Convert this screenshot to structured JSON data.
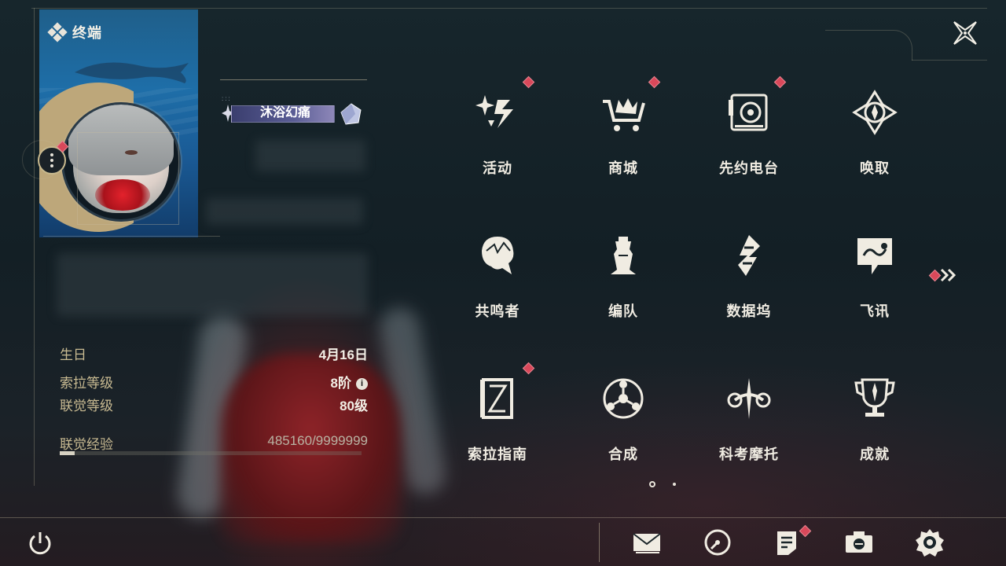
{
  "window": {
    "title": "终端"
  },
  "profile": {
    "title_badge": "沐浴幻痛",
    "stats": [
      {
        "label": "生日",
        "value": "4月16日"
      },
      {
        "label": "索拉等级",
        "value": "8阶"
      },
      {
        "label": "联觉等级",
        "value": "80级"
      }
    ],
    "exp": {
      "label": "联觉经验",
      "value": "485160/9999999",
      "fraction": 0.0485
    }
  },
  "menu": {
    "items": [
      {
        "label": "活动",
        "icon": "sparkle-icon",
        "badge": true
      },
      {
        "label": "商城",
        "icon": "cart-icon",
        "badge": true
      },
      {
        "label": "先约电台",
        "icon": "radio-icon",
        "badge": true
      },
      {
        "label": "唤取",
        "icon": "compass-icon",
        "badge": false
      },
      {
        "label": "共鸣者",
        "icon": "character-icon",
        "badge": false
      },
      {
        "label": "编队",
        "icon": "chess-icon",
        "badge": false
      },
      {
        "label": "数据坞",
        "icon": "data-icon",
        "badge": false
      },
      {
        "label": "飞讯",
        "icon": "chat-icon",
        "badge": false
      },
      {
        "label": "索拉指南",
        "icon": "guide-icon",
        "badge": true
      },
      {
        "label": "合成",
        "icon": "synthesis-icon",
        "badge": false
      },
      {
        "label": "科考摩托",
        "icon": "motorcycle-icon",
        "badge": false
      },
      {
        "label": "成就",
        "icon": "trophy-icon",
        "badge": false
      }
    ],
    "pages": {
      "current": 1,
      "total": 2
    }
  },
  "toolbar": {
    "buttons": [
      "mail-icon",
      "clock-icon",
      "notes-icon",
      "camera-icon",
      "settings-icon"
    ]
  },
  "colors": {
    "accent_gold": "#c9bb92",
    "badge_red": "#d9485a",
    "text": "#f0ece2",
    "background": "#16232a"
  }
}
